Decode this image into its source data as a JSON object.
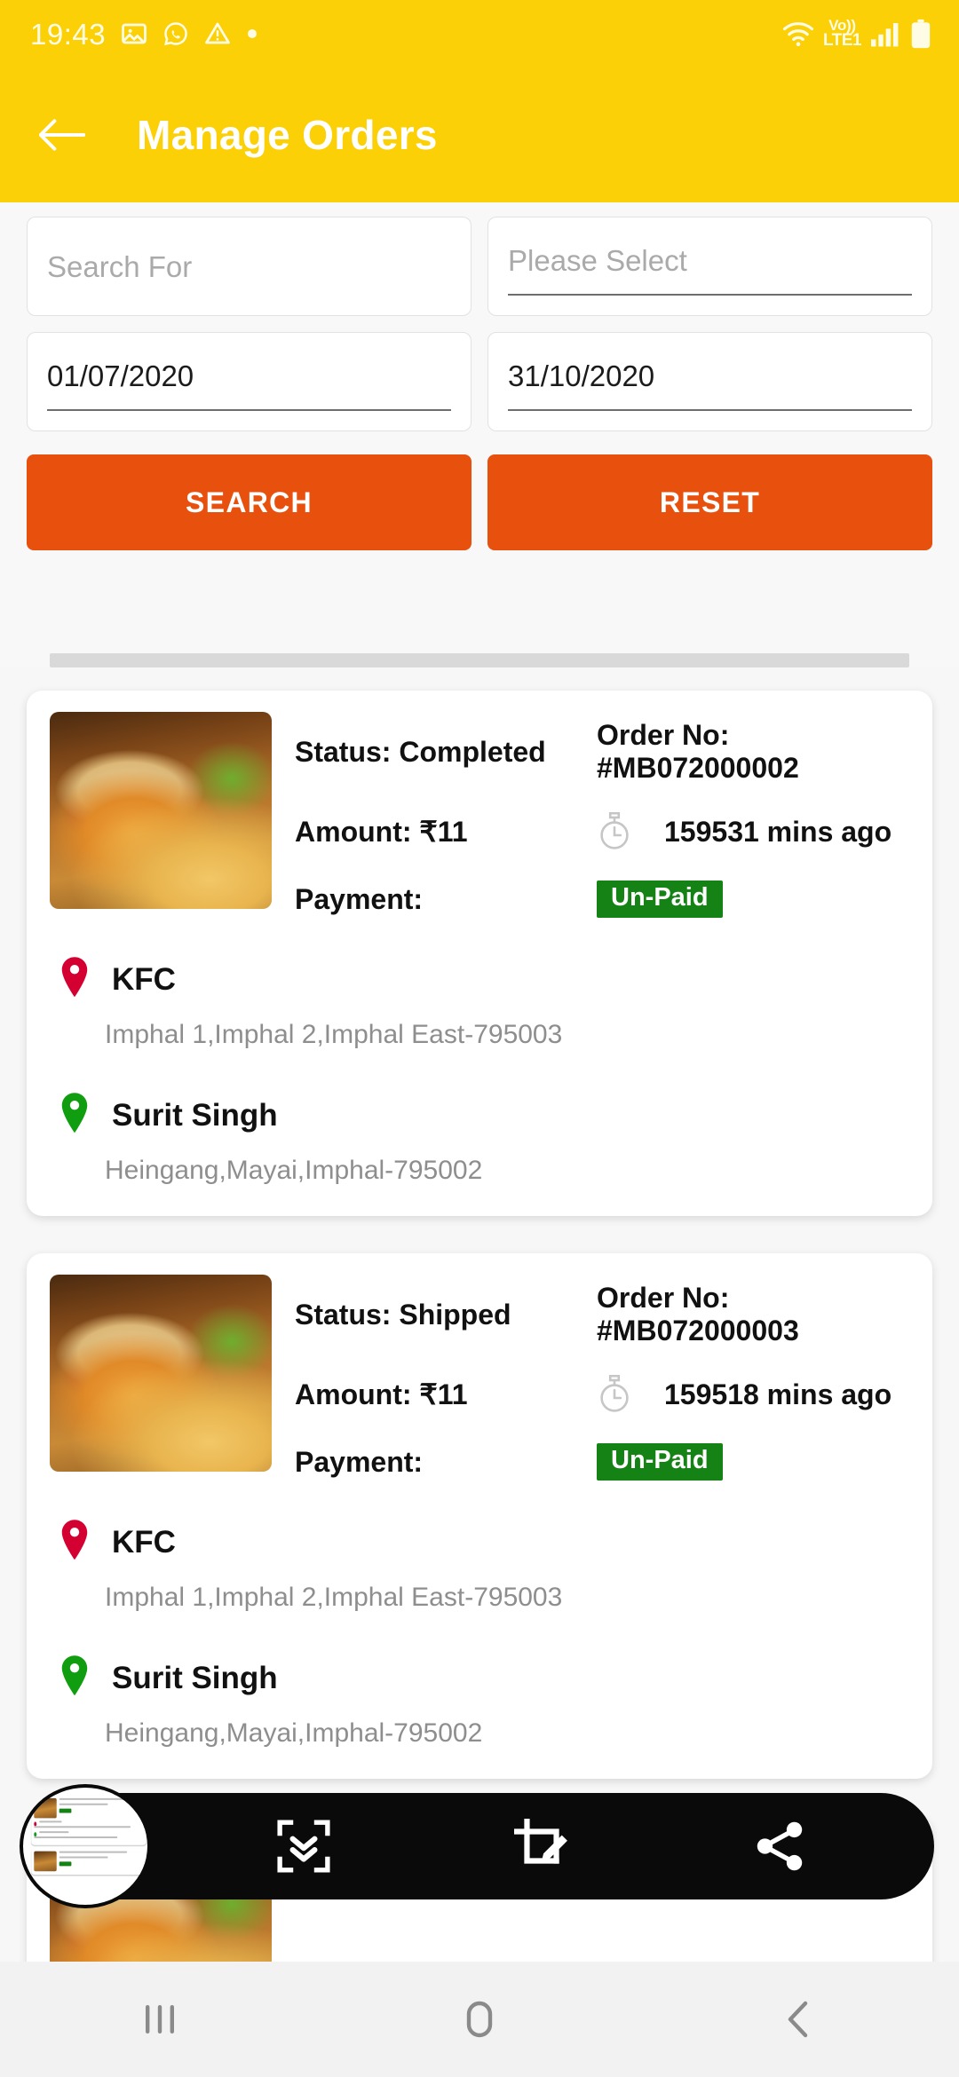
{
  "status_bar": {
    "time": "19:43",
    "left_icons": [
      "image-icon",
      "whatsapp-icon",
      "warning-icon",
      "dot-icon"
    ],
    "volte_line1": "Vo))",
    "volte_line2": "LTE1",
    "right_icons": [
      "wifi-icon",
      "volte-icon",
      "signal-icon",
      "battery-icon"
    ],
    "background_color": "#FCD006"
  },
  "app_bar": {
    "back_icon": "back-arrow-icon",
    "title": "Manage Orders",
    "background_color": "#FCD006",
    "title_color": "#FFFFFF"
  },
  "search_form": {
    "search_placeholder": "Search For",
    "search_value": "",
    "select_placeholder": "Please Select",
    "select_value": "",
    "date_from": "01/07/2020",
    "date_to": "31/10/2020",
    "search_button": "SEARCH",
    "reset_button": "RESET",
    "button_color": "#E8500E"
  },
  "orders": [
    {
      "status_label": "Status: Completed",
      "order_no_label": "Order No: #MB072000002",
      "amount_label": "Amount: ₹11",
      "time_ago": "159531 mins ago",
      "payment_label": "Payment:",
      "payment_badge": "Un-Paid",
      "payment_badge_color": "#148214",
      "pickup_name": "KFC",
      "pickup_address": "Imphal 1,Imphal 2,Imphal East-795003",
      "drop_name": "Surit Singh",
      "drop_address": "Heingang,Mayai,Imphal-795002",
      "thumbnail": "burger-fries-photo"
    },
    {
      "status_label": "Status: Shipped",
      "order_no_label": "Order No: #MB072000003",
      "amount_label": "Amount: ₹11",
      "time_ago": "159518 mins ago",
      "payment_label": "Payment:",
      "payment_badge": "Un-Paid",
      "payment_badge_color": "#148214",
      "pickup_name": "KFC",
      "pickup_address": "Imphal 1,Imphal 2,Imphal East-795003",
      "drop_name": "Surit Singh",
      "drop_address": "Heingang,Mayai,Imphal-795002",
      "thumbnail": "burger-fries-photo"
    }
  ],
  "screenshot_toolbar": {
    "preview_thumbnail": "screenshot-preview-thumbnail",
    "buttons": [
      {
        "name": "scroll-capture-icon"
      },
      {
        "name": "crop-edit-icon"
      },
      {
        "name": "share-icon"
      }
    ],
    "background_color": "#0A0A0A"
  },
  "nav_bar": {
    "recents_icon": "recents-icon",
    "home_icon": "home-icon",
    "back_icon": "back-icon",
    "background_color": "#F2F2F2"
  }
}
